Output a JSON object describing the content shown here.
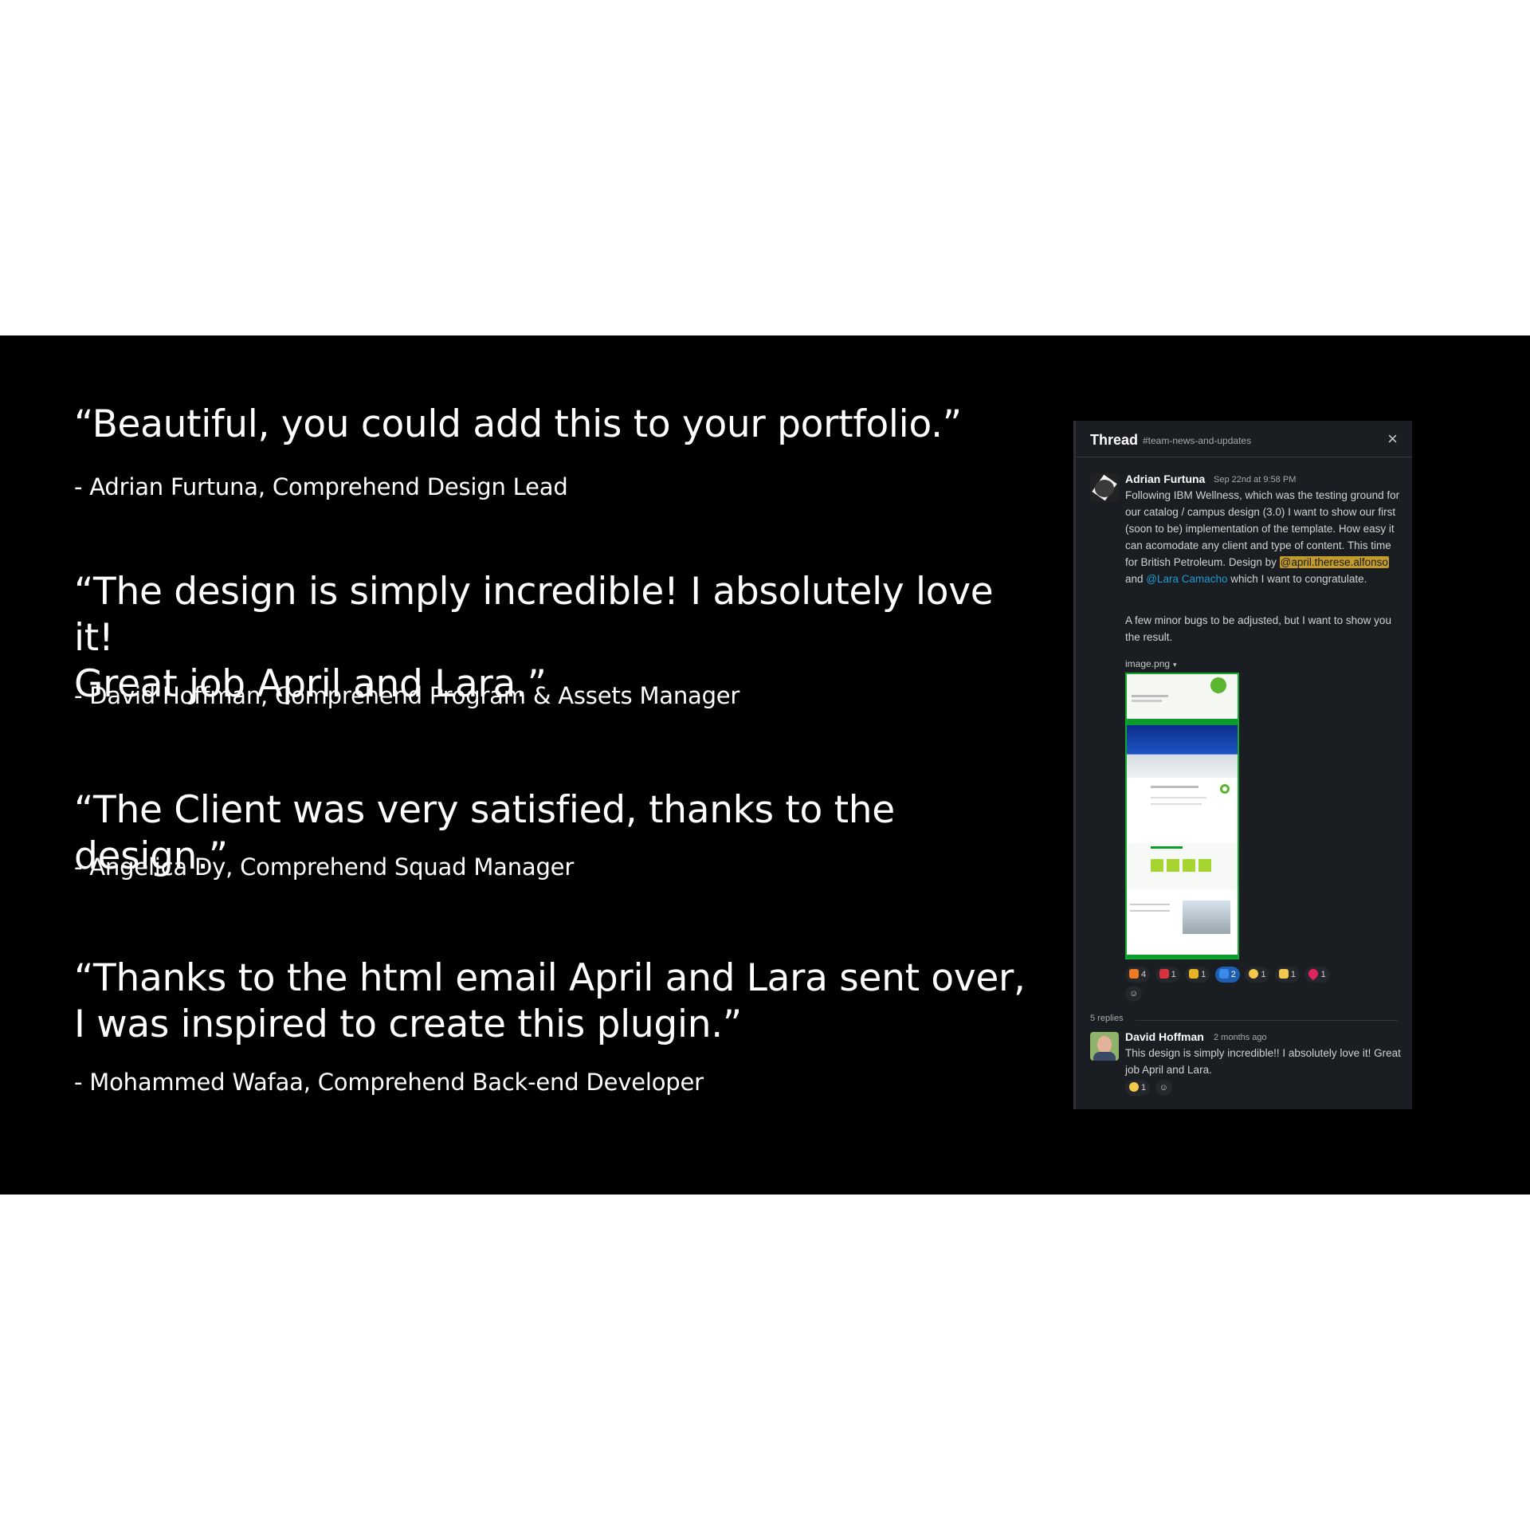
{
  "testimonials": [
    {
      "quote": "“Beautiful, you could add this to your portfolio.”",
      "author": "- Adrian Furtuna, Comprehend Design Lead"
    },
    {
      "quote_line1": "“The design is simply incredible! I absolutely love it!",
      "quote_line2": "Great job April and Lara.”",
      "author": "- David Hoffman, Comprehend Program & Assets Manager"
    },
    {
      "quote": "“The Client was very satisfied, thanks to the design.”",
      "author": "- Angelica Dy, Comprehend Squad Manager"
    },
    {
      "quote_line1": "“Thanks to the html email April and Lara sent over,",
      "quote_line2": "I was inspired to create this plugin.”",
      "author": "- Mohammed Wafaa, Comprehend Back-end Developer"
    }
  ],
  "thread": {
    "title": "Thread",
    "channel": "#team-news-and-updates",
    "close_icon": "×",
    "message": {
      "author": "Adrian Furtuna",
      "time": "Sep 22nd at 9:58 PM",
      "paragraph1": "Following IBM Wellness, which was the testing ground for our  catalog / campus design (3.0) I want to show our first (soon to be) implementation of the template. How easy it can acomodate any client and type of content. This time for British Petroleum.",
      "design_by": "Design by ",
      "mention1": "@april.therese.alfonso",
      "and": " and ",
      "mention2": "@Lara Camacho",
      "congrats": " which I want to congratulate.",
      "paragraph2": "A few minor bugs to be adjusted, but I want to show you the result.",
      "attachment": "image.png",
      "attachment_caret": "▾"
    },
    "reactions": [
      {
        "icon": "fire-icon",
        "count": "4",
        "color": "#f07a24"
      },
      {
        "icon": "badge-icon",
        "count": "1",
        "color": "#d8323c"
      },
      {
        "icon": "crown-icon",
        "count": "1",
        "color": "#e6b422"
      },
      {
        "icon": "yes-icon",
        "count": "2",
        "color": "#3a8be8"
      },
      {
        "icon": "face-icon",
        "count": "1",
        "color": "#f2c94c"
      },
      {
        "icon": "party-icon",
        "count": "1",
        "color": "#f2c94c"
      },
      {
        "icon": "heart-icon",
        "count": "1",
        "color": "#e0245e"
      }
    ],
    "add_reaction_icon": "☺",
    "replies_label": "5 replies",
    "reply": {
      "author": "David Hoffman",
      "time": "2 months ago",
      "text": "This design is simply incredible!!  I absolutely love it! Great job April and Lara.",
      "reaction_count": "1"
    }
  }
}
